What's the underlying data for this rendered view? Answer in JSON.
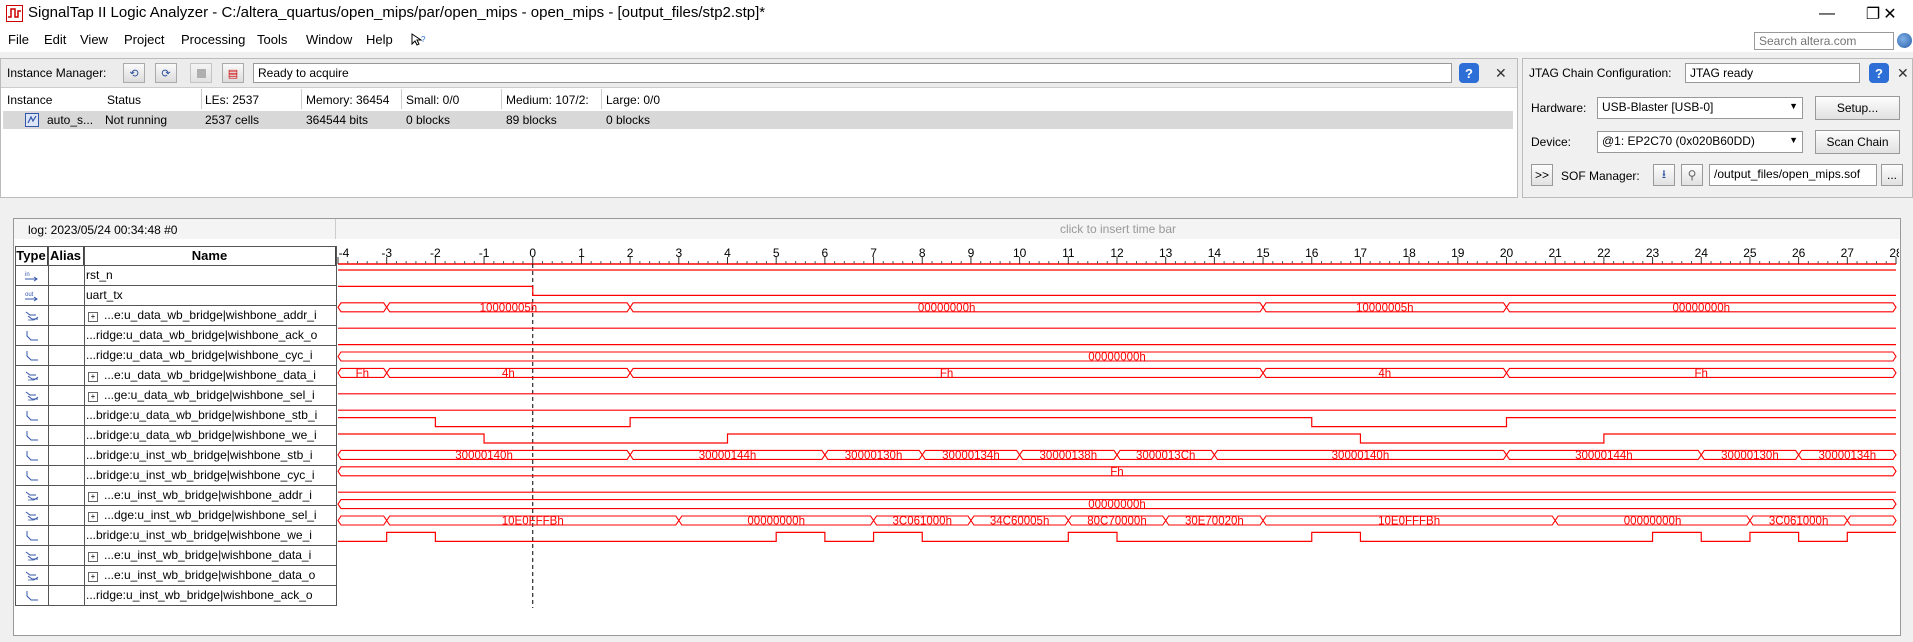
{
  "window": {
    "title": "SignalTap II Logic Analyzer - C:/altera_quartus/open_mips/par/open_mips - open_mips - [output_files/stp2.stp]*",
    "controls": {
      "minimize": "—",
      "maximize": "❐",
      "close": "✕"
    }
  },
  "menu": {
    "items": [
      "File",
      "Edit",
      "View",
      "Project",
      "Processing",
      "Tools",
      "Window",
      "Help"
    ],
    "search_placeholder": "Search altera.com"
  },
  "instance_manager": {
    "label": "Instance Manager:",
    "status": "Ready to acquire",
    "columns": [
      "Instance",
      "Status",
      "LEs: 2537",
      "Memory: 36454",
      "Small: 0/0",
      "Medium: 107/2:",
      "Large: 0/0"
    ],
    "row": [
      "auto_s...",
      "Not running",
      "2537 cells",
      "364544 bits",
      "0 blocks",
      "89 blocks",
      "0 blocks"
    ]
  },
  "jtag": {
    "config_label": "JTAG Chain Configuration:",
    "config_status": "JTAG ready",
    "hardware_label": "Hardware:",
    "hardware_value": "USB-Blaster [USB-0]",
    "setup_button": "Setup...",
    "device_label": "Device:",
    "device_value": "@1: EP2C70 (0x020B60DD)",
    "scan_button": "Scan Chain",
    "expand_button": ">>",
    "sof_label": "SOF Manager:",
    "sof_path": "/output_files/open_mips.sof",
    "browse_button": "..."
  },
  "waveform": {
    "log_label": "log: 2023/05/24 00:34:48  #0",
    "insert_hint": "click to insert time bar",
    "headers": {
      "type": "Type",
      "alias": "Alias",
      "name": "Name"
    },
    "time_ticks": [
      "-4",
      "-3",
      "-2",
      "-1",
      "0",
      "1",
      "2",
      "3",
      "4",
      "5",
      "6",
      "7",
      "8",
      "9",
      "10",
      "11",
      "12",
      "13",
      "14",
      "15",
      "16",
      "17",
      "18",
      "19",
      "20",
      "21",
      "22",
      "23",
      "24",
      "25",
      "26",
      "27",
      "28"
    ],
    "wave_color": "#ff0000",
    "signals": [
      {
        "name": "rst_n",
        "type": "in",
        "bus": false
      },
      {
        "name": "uart_tx",
        "type": "out",
        "bus": false
      },
      {
        "name": "...e:u_data_wb_bridge|wishbone_addr_i",
        "type": "bus",
        "bus": true
      },
      {
        "name": "...ridge:u_data_wb_bridge|wishbone_ack_o",
        "type": "node",
        "bus": false
      },
      {
        "name": "...ridge:u_data_wb_bridge|wishbone_cyc_i",
        "type": "node",
        "bus": false
      },
      {
        "name": "...e:u_data_wb_bridge|wishbone_data_i",
        "type": "bus",
        "bus": true
      },
      {
        "name": "...ge:u_data_wb_bridge|wishbone_sel_i",
        "type": "bus",
        "bus": true
      },
      {
        "name": "...bridge:u_data_wb_bridge|wishbone_stb_i",
        "type": "node",
        "bus": false
      },
      {
        "name": "...bridge:u_data_wb_bridge|wishbone_we_i",
        "type": "node",
        "bus": false
      },
      {
        "name": "...bridge:u_inst_wb_bridge|wishbone_stb_i",
        "type": "node",
        "bus": false
      },
      {
        "name": "...bridge:u_inst_wb_bridge|wishbone_cyc_i",
        "type": "node",
        "bus": false
      },
      {
        "name": "...e:u_inst_wb_bridge|wishbone_addr_i",
        "type": "bus",
        "bus": true
      },
      {
        "name": "...dge:u_inst_wb_bridge|wishbone_sel_i",
        "type": "bus",
        "bus": true
      },
      {
        "name": "...bridge:u_inst_wb_bridge|wishbone_we_i",
        "type": "node",
        "bus": false
      },
      {
        "name": "...e:u_inst_wb_bridge|wishbone_data_i",
        "type": "bus",
        "bus": true
      },
      {
        "name": "...e:u_inst_wb_bridge|wishbone_data_o",
        "type": "bus",
        "bus": true
      },
      {
        "name": "...ridge:u_inst_wb_bridge|wishbone_ack_o",
        "type": "node",
        "bus": false
      }
    ],
    "waves": [
      {
        "kind": "digital",
        "initial": 1,
        "transitions": []
      },
      {
        "kind": "digital",
        "initial": 1,
        "transitions": [
          0
        ]
      },
      {
        "kind": "bus",
        "segments": [
          {
            "from": -4,
            "to": -3,
            "label": ""
          },
          {
            "from": -3,
            "to": 2,
            "label": "10000005h"
          },
          {
            "from": 2,
            "to": 15,
            "label": "00000000h"
          },
          {
            "from": 15,
            "to": 20,
            "label": "10000005h"
          },
          {
            "from": 20,
            "to": 28,
            "label": "00000000h"
          }
        ]
      },
      {
        "kind": "digital",
        "initial": 0,
        "transitions": []
      },
      {
        "kind": "digital",
        "initial": 0,
        "transitions": []
      },
      {
        "kind": "bus",
        "segments": [
          {
            "from": -4,
            "to": 28,
            "label": "00000000h"
          }
        ]
      },
      {
        "kind": "bus",
        "segments": [
          {
            "from": -4,
            "to": -3,
            "label": "Fh"
          },
          {
            "from": -3,
            "to": 2,
            "label": "4h"
          },
          {
            "from": 2,
            "to": 15,
            "label": "Fh"
          },
          {
            "from": 15,
            "to": 20,
            "label": "4h"
          },
          {
            "from": 20,
            "to": 28,
            "label": "Fh"
          }
        ]
      },
      {
        "kind": "digital",
        "initial": 0,
        "transitions": []
      },
      {
        "kind": "digital",
        "initial": 0,
        "transitions": []
      },
      {
        "kind": "digital",
        "initial": 1,
        "transitions": [
          -2,
          2,
          16,
          20
        ]
      },
      {
        "kind": "digital",
        "initial": 1,
        "transitions": [
          -1,
          4,
          17,
          22
        ]
      },
      {
        "kind": "bus",
        "segments": [
          {
            "from": -4,
            "to": 2,
            "label": "30000140h"
          },
          {
            "from": 2,
            "to": 6,
            "label": "30000144h"
          },
          {
            "from": 6,
            "to": 8,
            "label": "30000130h"
          },
          {
            "from": 8,
            "to": 10,
            "label": "30000134h"
          },
          {
            "from": 10,
            "to": 12,
            "label": "30000138h"
          },
          {
            "from": 12,
            "to": 14,
            "label": "3000013Ch"
          },
          {
            "from": 14,
            "to": 20,
            "label": "30000140h"
          },
          {
            "from": 20,
            "to": 24,
            "label": "30000144h"
          },
          {
            "from": 24,
            "to": 26,
            "label": "30000130h"
          },
          {
            "from": 26,
            "to": 28,
            "label": "30000134h"
          }
        ]
      },
      {
        "kind": "bus",
        "segments": [
          {
            "from": -4,
            "to": 28,
            "label": "Fh"
          }
        ]
      },
      {
        "kind": "digital",
        "initial": 0,
        "transitions": []
      },
      {
        "kind": "bus",
        "segments": [
          {
            "from": -4,
            "to": 28,
            "label": "00000000h"
          }
        ]
      },
      {
        "kind": "bus",
        "segments": [
          {
            "from": -4,
            "to": -3,
            "label": ""
          },
          {
            "from": -3,
            "to": 3,
            "label": "10E0FFFBh"
          },
          {
            "from": 3,
            "to": 7,
            "label": "00000000h"
          },
          {
            "from": 7,
            "to": 9,
            "label": "3C061000h"
          },
          {
            "from": 9,
            "to": 11,
            "label": "34C60005h"
          },
          {
            "from": 11,
            "to": 13,
            "label": "80C70000h"
          },
          {
            "from": 13,
            "to": 15,
            "label": "30E70020h"
          },
          {
            "from": 15,
            "to": 21,
            "label": "10E0FFFBh"
          },
          {
            "from": 21,
            "to": 25,
            "label": "00000000h"
          },
          {
            "from": 25,
            "to": 27,
            "label": "3C061000h"
          },
          {
            "from": 27,
            "to": 28,
            "label": ""
          }
        ]
      },
      {
        "kind": "digital",
        "initial": 0,
        "transitions": [
          -3,
          -2,
          5,
          6,
          7,
          8,
          11,
          12,
          16,
          17,
          23,
          24,
          25,
          26,
          27
        ]
      }
    ]
  }
}
